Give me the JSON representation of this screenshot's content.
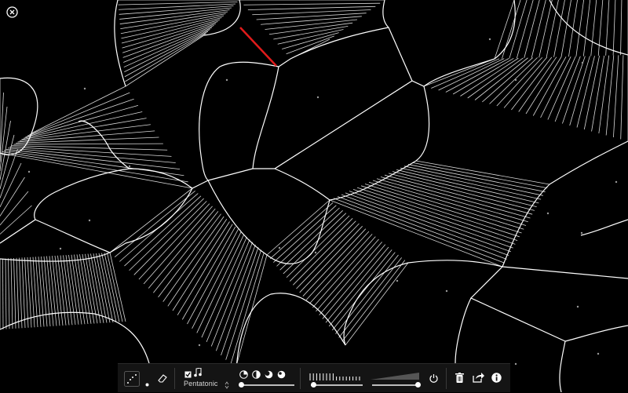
{
  "app": {
    "close_icon": "close-circle-icon"
  },
  "toolbar": {
    "draw_tool_icon": "draw-dotted-line-icon",
    "dot_size_icon": "dot-icon",
    "eraser_icon": "eraser-icon",
    "snap_checkbox_checked": true,
    "note_icon": "music-note-icon",
    "scale_label": "Pentatonic",
    "scale_stepper_icon": "up-down-arrows-icon",
    "shape_icons": [
      "wedge-circle-icon",
      "half-moon-icon",
      "crescent-icon",
      "moon-icon"
    ],
    "tempo_level": 0.06,
    "volume_level": 1.0,
    "power_icon": "power-icon",
    "trash_icon": "trash-icon",
    "share_icon": "share-icon",
    "info_icon": "info-icon"
  },
  "colors": {
    "background": "#000000",
    "lines": "#ffffff",
    "accent": "#e01b1b",
    "toolbar": "#141414"
  }
}
